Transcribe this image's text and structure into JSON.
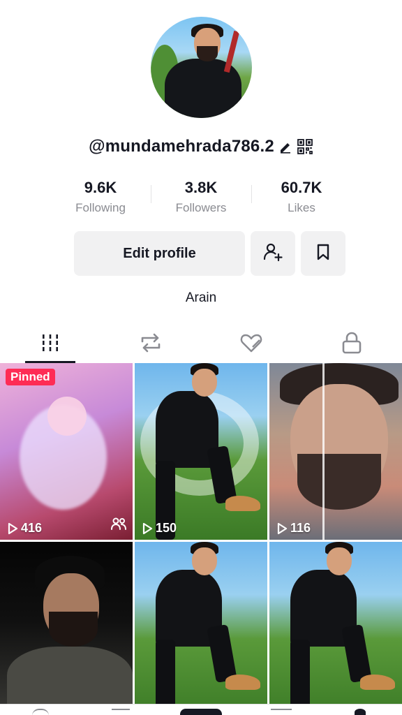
{
  "profile": {
    "username": "@mundamehrada786.2",
    "bio": "Arain"
  },
  "stats": [
    {
      "value": "9.6K",
      "label": "Following"
    },
    {
      "value": "3.8K",
      "label": "Followers"
    },
    {
      "value": "60.7K",
      "label": "Likes"
    }
  ],
  "actions": {
    "edit_profile": "Edit profile"
  },
  "tabs": [
    {
      "icon": "grid-videos-icon",
      "active": true
    },
    {
      "icon": "repost-icon",
      "active": false
    },
    {
      "icon": "liked-heart-icon",
      "active": false
    },
    {
      "icon": "lock-icon",
      "active": false
    }
  ],
  "videos": [
    {
      "views": "416",
      "badge": "Pinned",
      "icon": "friends-icon"
    },
    {
      "views": "150"
    },
    {
      "views": "116"
    },
    {
      "views": ""
    },
    {
      "views": ""
    },
    {
      "views": ""
    }
  ],
  "colors": {
    "accent": "#fe2c55",
    "text": "#161823",
    "muted": "#8a8b91",
    "button_bg": "#f1f1f2"
  }
}
